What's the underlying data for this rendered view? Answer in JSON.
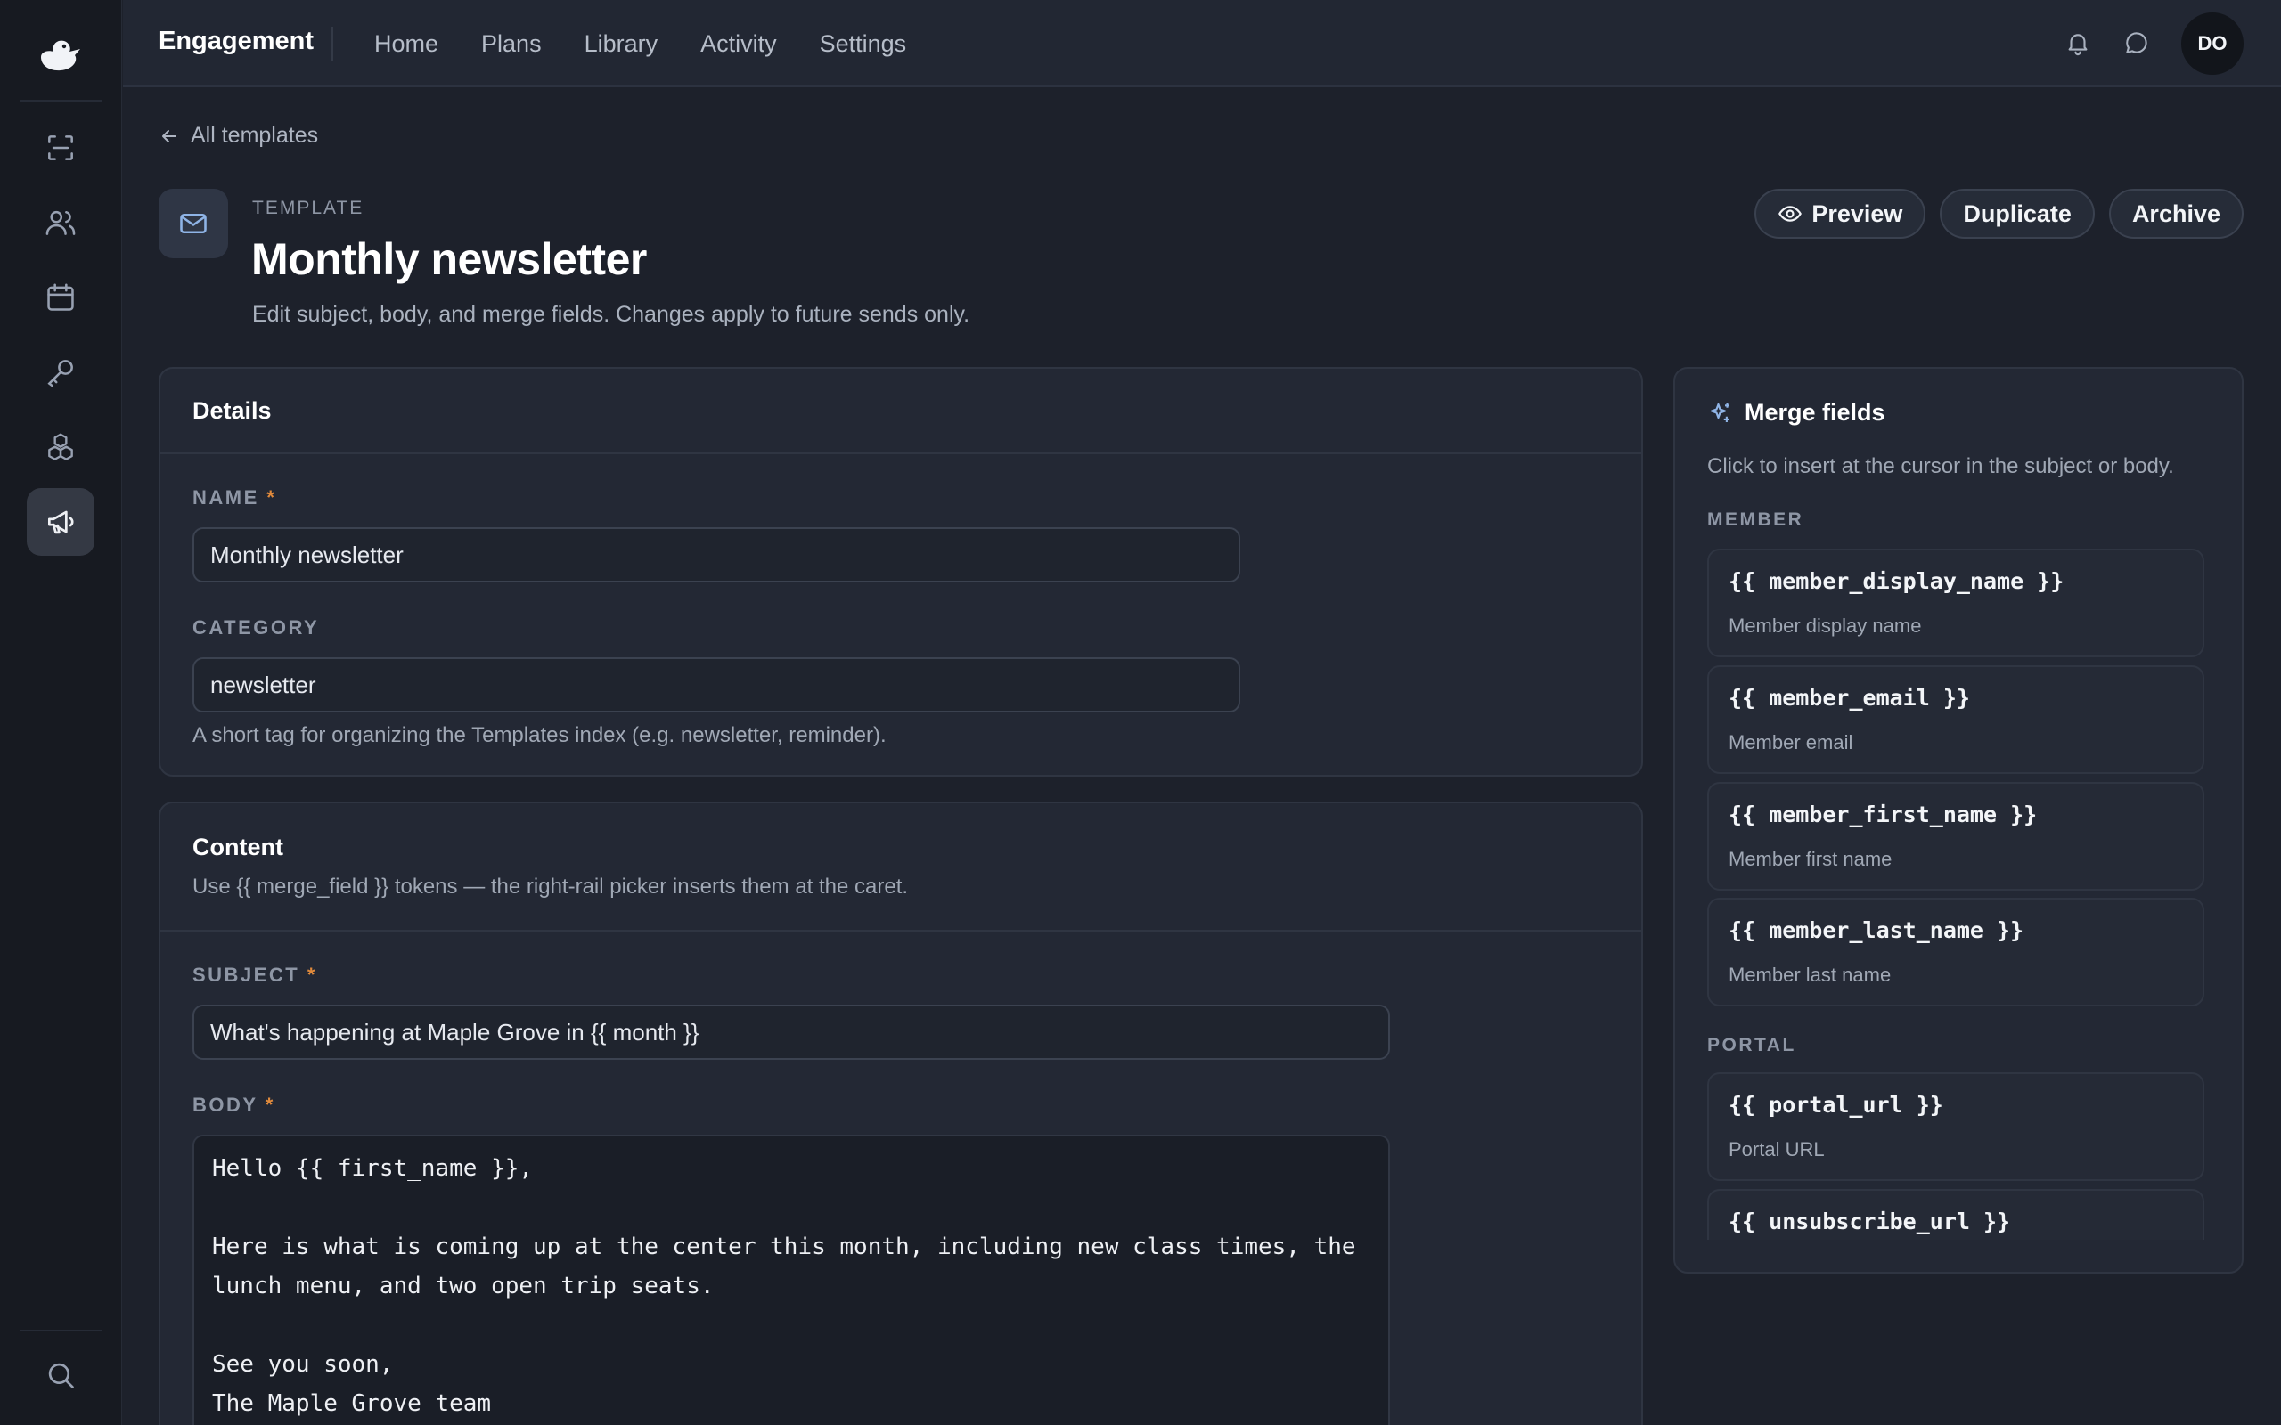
{
  "app": {
    "title": "Engagement",
    "avatar_initials": "DO"
  },
  "nav": [
    "Home",
    "Plans",
    "Library",
    "Activity",
    "Settings"
  ],
  "rail": {
    "icons": [
      "scan-icon",
      "users-icon",
      "calendar-icon",
      "key-icon",
      "boxes-icon",
      "megaphone-icon",
      "search-icon"
    ],
    "active": "megaphone-icon"
  },
  "header": {
    "back_label": "All templates",
    "eyebrow": "TEMPLATE",
    "title": "Monthly newsletter",
    "subtitle": "Edit subject, body, and merge fields. Changes apply to future sends only.",
    "actions": {
      "preview": "Preview",
      "duplicate": "Duplicate",
      "archive": "Archive"
    }
  },
  "details": {
    "title": "Details",
    "name_label": "NAME",
    "name_value": "Monthly newsletter",
    "category_label": "CATEGORY",
    "category_value": "newsletter",
    "category_hint": "A short tag for organizing the Templates index (e.g. newsletter, reminder)."
  },
  "content": {
    "title": "Content",
    "description": "Use {{ merge_field }} tokens — the right-rail picker inserts them at the caret.",
    "subject_label": "SUBJECT",
    "subject_value": "What's happening at Maple Grove in {{ month }}",
    "body_label": "BODY",
    "body_value": "Hello {{ first_name }},\n\nHere is what is coming up at the center this month, including new class times, the\nlunch menu, and two open trip seats.\n\nSee you soon,\nThe Maple Grove team"
  },
  "merge_fields": {
    "title": "Merge fields",
    "description": "Click to insert at the cursor in the subject or body.",
    "groups": [
      {
        "label": "MEMBER",
        "items": [
          {
            "code": "{{ member_display_name }}",
            "label": "Member display name"
          },
          {
            "code": "{{ member_email }}",
            "label": "Member email"
          },
          {
            "code": "{{ member_first_name }}",
            "label": "Member first name"
          },
          {
            "code": "{{ member_last_name }}",
            "label": "Member last name"
          }
        ]
      },
      {
        "label": "PORTAL",
        "items": [
          {
            "code": "{{ portal_url }}",
            "label": "Portal URL"
          },
          {
            "code": "{{ unsubscribe_url }}",
            "label": ""
          }
        ]
      }
    ]
  },
  "required_marker": "*",
  "colors": {
    "accent": "#8fb4e6",
    "required": "#e08a3c",
    "background": "#1d212b",
    "card": "#232834"
  }
}
